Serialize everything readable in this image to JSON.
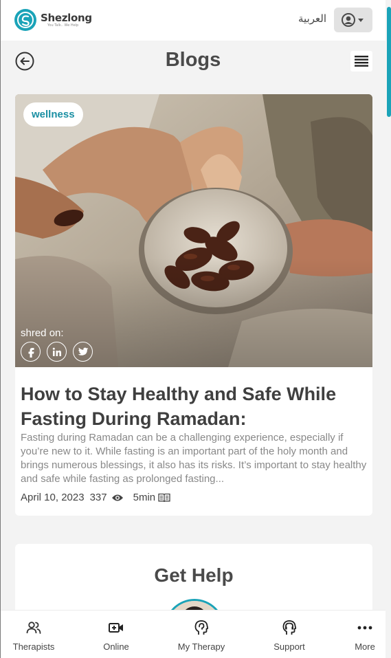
{
  "header": {
    "brand_name": "Shezlong",
    "brand_tagline": "You Talk.. We Help",
    "language_label": "العربية"
  },
  "page": {
    "title": "Blogs"
  },
  "post": {
    "tag": "wellness",
    "shared_label": "shred on:",
    "share_networks": [
      "facebook-icon",
      "linkedin-icon",
      "twitter-icon"
    ],
    "title": "How to Stay Healthy and Safe While Fasting During Ramadan:",
    "excerpt": "Fasting during Ramadan can be a challenging experience, especially if you’re new to it. While fasting is an important part of the holy month and brings numerous blessings, it also has its risks. It’s important to stay healthy and safe while fasting as prolonged fasting...",
    "date": "April 10, 2023",
    "views": "337",
    "read_time": "5min"
  },
  "help": {
    "title": "Get Help"
  },
  "nav": {
    "items": [
      {
        "label": "Therapists",
        "icon": "therapists-icon"
      },
      {
        "label": "Online",
        "icon": "video-add-icon"
      },
      {
        "label": "My Therapy",
        "icon": "head-brain-icon"
      },
      {
        "label": "Support",
        "icon": "headset-icon"
      },
      {
        "label": "More",
        "icon": "more-dots-icon"
      }
    ]
  },
  "colors": {
    "brand": "#1aa3b8",
    "text_dark": "#3f3f3f",
    "text_muted": "#888888"
  }
}
